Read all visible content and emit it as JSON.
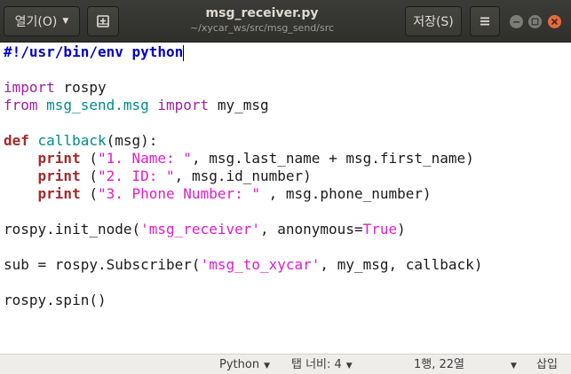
{
  "header": {
    "open_label": "열기(O)",
    "title": "msg_receiver.py",
    "subtitle": "~/xycar_ws/src/msg_send/src",
    "save_label": "저장(S)",
    "icons": {
      "open_dropdown": "chevron-down-icon",
      "new_tab": "new-document-icon",
      "menu": "hamburger-menu-icon",
      "minimize": "minimize-icon",
      "maximize": "maximize-icon",
      "close": "close-icon"
    }
  },
  "editor": {
    "lines": [
      "#!/usr/bin/env python",
      "",
      "import rospy",
      "from msg_send.msg import my_msg",
      "",
      "def callback(msg):",
      "    print (\"1. Name: \", msg.last_name + msg.first_name)",
      "    print (\"2. ID: \", msg.id_number)",
      "    print (\"3. Phone Number: \" , msg.phone_number)",
      "",
      "rospy.init_node('msg_receiver', anonymous=True)",
      "",
      "sub = rospy.Subscriber('msg_to_xycar', my_msg, callback)",
      "",
      "rospy.spin()"
    ],
    "tokens": {
      "l0": "#!/usr/bin/env python",
      "import": "import",
      "rospy": " rospy",
      "from": "from",
      "mod": " msg_send.msg ",
      "import2": "import",
      "mymsg": " my_msg",
      "def": "def",
      "callback_name": " callback",
      "callback_args": "(msg):",
      "indent": "    ",
      "print": "print",
      "p1_open": " (",
      "p1_str": "\"1. Name: \"",
      "p1_rest": ", msg.last_name + msg.first_name)",
      "p2_open": " (",
      "p2_str": "\"2. ID: \"",
      "p2_rest": ", msg.id_number)",
      "p3_open": " (",
      "p3_str": "\"3. Phone Number: \"",
      "p3_rest": " , msg.phone_number)",
      "init_pre": "rospy.init_node(",
      "init_str": "'msg_receiver'",
      "init_mid": ", anonymous=",
      "init_true": "True",
      "init_end": ")",
      "sub_pre": "sub = rospy.Subscriber(",
      "sub_str": "'msg_to_xycar'",
      "sub_rest": ", my_msg, callback)",
      "spin": "rospy.spin()"
    }
  },
  "statusbar": {
    "language": "Python",
    "tab_width": "탭 너비: 4",
    "position": "1행, 22열",
    "insert_mode": "삽입"
  },
  "colors": {
    "header_bg": "#353532",
    "close_button": "#e9693c",
    "shebang": "#0000c8",
    "preproc": "#a020a0",
    "string": "#e01cd1",
    "keyword": "#a52a2a",
    "identifier": "#008a8c"
  }
}
